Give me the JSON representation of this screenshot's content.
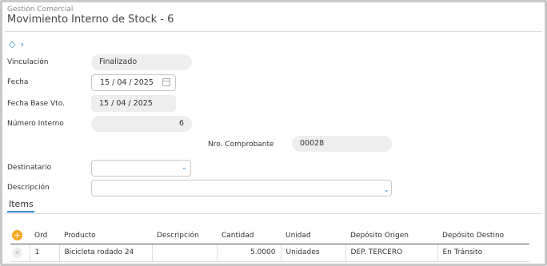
{
  "header": {
    "module": "Gestión Comercial",
    "title": "Movimiento Interno de Stock - 6"
  },
  "toolbar": {
    "tag_icon": "tag-icon",
    "expand_icon": "chevron-right-icon"
  },
  "form": {
    "vinculacion": {
      "label": "Vinculación",
      "value": "Finalizado"
    },
    "fecha": {
      "label": "Fecha",
      "value": "15 / 04 / 2025"
    },
    "fecha_base": {
      "label": "Fecha Base Vto.",
      "value": "15 / 04 / 2025"
    },
    "numero_interno": {
      "label": "Número Interno",
      "value": "6"
    },
    "nro_comprobante": {
      "label": "Nro. Comprobante",
      "value": "00028"
    },
    "destinatario": {
      "label": "Destinatario",
      "value": ""
    },
    "descripcion": {
      "label": "Descripción",
      "value": ""
    }
  },
  "items": {
    "tab_label": "Items",
    "columns": [
      "Ord",
      "Producto",
      "Descripción",
      "Cantidad",
      "Unidad",
      "Depósito Origen",
      "Depósito Destino"
    ],
    "rows": [
      {
        "ord": "1",
        "producto": "Bicicleta rodado 24",
        "descripcion": "",
        "cantidad": "5.0000",
        "unidad": "Unidades",
        "origen": "DEP. TERCERO",
        "destino": "En Tránsito"
      }
    ]
  },
  "colors": {
    "accent": "#2a8cd0",
    "add_button": "#f5a623"
  }
}
